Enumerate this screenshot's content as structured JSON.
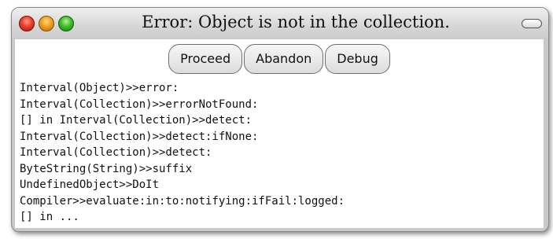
{
  "window": {
    "title": "Error: Object is not in the collection."
  },
  "buttons": {
    "proceed": "Proceed",
    "abandon": "Abandon",
    "debug": "Debug"
  },
  "stack_trace": [
    "Interval(Object)>>error:",
    "Interval(Collection)>>errorNotFound:",
    "[] in Interval(Collection)>>detect:",
    "Interval(Collection)>>detect:ifNone:",
    "Interval(Collection)>>detect:",
    "ByteString(String)>>suffix",
    "UndefinedObject>>DoIt",
    "Compiler>>evaluate:in:to:notifying:ifFail:logged:",
    "[] in ..."
  ],
  "colors": {
    "close": "#e8402a",
    "minimize": "#f0a020",
    "maximize": "#3fbe2a"
  }
}
